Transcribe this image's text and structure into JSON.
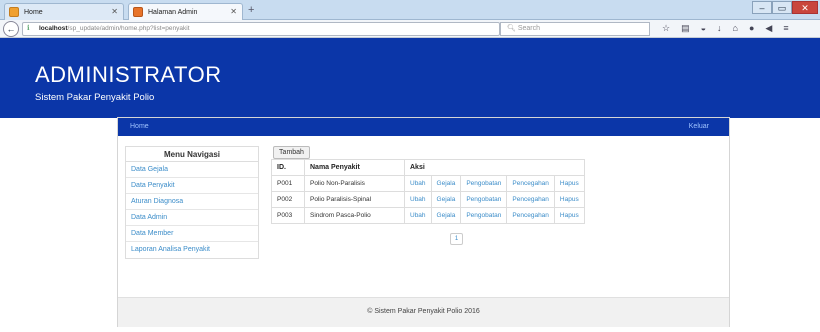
{
  "browser": {
    "tabs": [
      {
        "title": "Home",
        "favicon_color": "#f0a030"
      },
      {
        "title": "Halaman Admin",
        "favicon_color": "#e8742a"
      }
    ],
    "url_host": "localhost",
    "url_path": "/sp_update/admin/home.php?list=penyakit",
    "search_placeholder": "Search"
  },
  "header": {
    "title": "ADMINISTRATOR",
    "subtitle": "Sistem Pakar Penyakit Polio",
    "bg_color": "#0b36a8"
  },
  "topnav": {
    "home": "Home",
    "logout": "Keluar"
  },
  "menu": {
    "title": "Menu Navigasi",
    "items": [
      "Data Gejala",
      "Data Penyakit",
      "Aturan Diagnosa",
      "Data Admin",
      "Data Member",
      "Laporan Analisa Penyakit"
    ]
  },
  "content": {
    "add_button": "Tambah",
    "columns": [
      "ID.",
      "Nama Penyakit",
      "Aksi"
    ],
    "rows": [
      {
        "id": "P001",
        "name": "Polio Non-Paralisis",
        "a1": "Ubah",
        "a2": "Gejala",
        "a3": "Pengobatan",
        "a4": "Pencegahan",
        "a5": "Hapus"
      },
      {
        "id": "P002",
        "name": "Polio Paralisis-Spinal",
        "a1": "Ubah",
        "a2": "Gejala",
        "a3": "Pengobatan",
        "a4": "Pencegahan",
        "a5": "Hapus"
      },
      {
        "id": "P003",
        "name": "Sindrom Pasca-Polio",
        "a1": "Ubah",
        "a2": "Gejala",
        "a3": "Pengobatan",
        "a4": "Pencegahan",
        "a5": "Hapus"
      }
    ],
    "page": "1"
  },
  "footer": "© Sistem Pakar Penyakit Polio 2016"
}
